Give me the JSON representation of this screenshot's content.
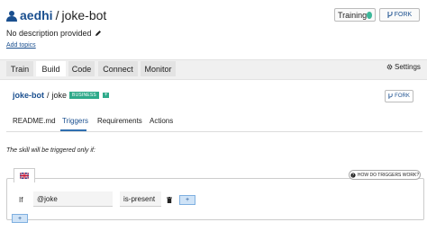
{
  "header": {
    "owner": "aedhi",
    "separator": "/",
    "repo": "joke-bot",
    "training_label": "Training",
    "fork_label": "FORK",
    "description": "No description provided",
    "add_topics": "Add topics"
  },
  "tabs": [
    {
      "label": "Train"
    },
    {
      "label": "Build"
    },
    {
      "label": "Code"
    },
    {
      "label": "Connect"
    },
    {
      "label": "Monitor"
    }
  ],
  "settings_label": "Settings",
  "skill": {
    "owner": "joke-bot",
    "separator": "/",
    "name": "joke",
    "badge": "BUSINESS",
    "badge_extra": "+",
    "fork_label": "FORK"
  },
  "subtabs": [
    {
      "label": "README.md"
    },
    {
      "label": "Triggers"
    },
    {
      "label": "Requirements"
    },
    {
      "label": "Actions"
    }
  ],
  "trigger_note": "The skill will be triggered only if:",
  "trigger": {
    "how_label": "HOW DO TRIGGERS WORK?",
    "if_label": "If",
    "field_value": "@joke",
    "operator_value": "is-present",
    "add_value_label": "+",
    "add_condition_label": "+"
  },
  "colors": {
    "accent": "#1a4f8f",
    "status_green": "#3cb89a",
    "badge_green": "#2eaa8a"
  },
  "icons": {
    "user": "user-icon",
    "pencil": "pencil-icon",
    "fork": "fork-icon",
    "gear": "gear-icon",
    "flag": "uk-flag-icon",
    "help": "help-circle-icon",
    "trash": "trash-icon"
  }
}
